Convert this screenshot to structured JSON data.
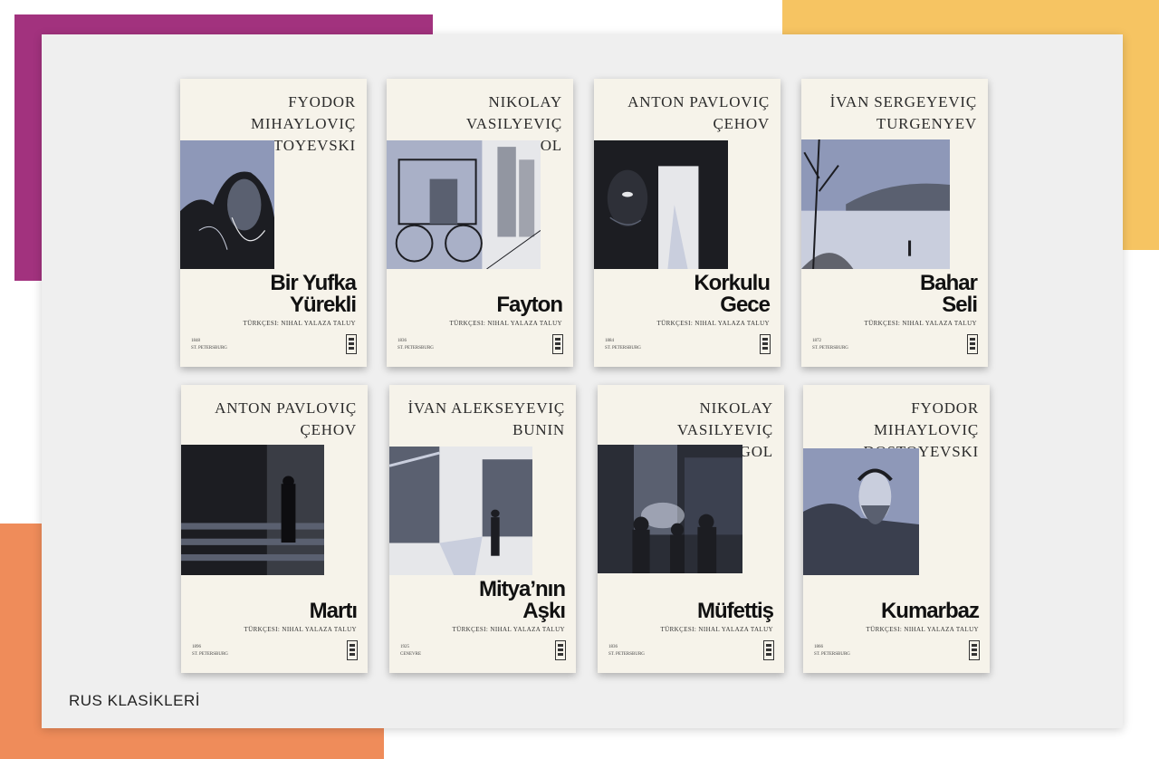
{
  "page": {
    "footer_label": "RUS KLASİKLERİ",
    "colors": {
      "magenta": "#a2327e",
      "yellow": "#f6c462",
      "orange": "#ef8c5a",
      "panel": "#efefef",
      "cover": "#f6f3ea",
      "art_tint": "#8e98b8"
    }
  },
  "books": [
    {
      "author": [
        "Fyodor Mihayloviç",
        "Dostoyevski"
      ],
      "title": [
        "Bir Yufka",
        "Yürekli"
      ],
      "translator": "Türkçesi: Nihal Yalaza Taluy",
      "meta": [
        "1848",
        "St. Petersburg"
      ],
      "art": "portrait-head-bowed"
    },
    {
      "author": [
        "Nikolay Vasilyeviç",
        "Gogol"
      ],
      "title": [
        "Fayton"
      ],
      "translator": "Türkçesi: Nihal Yalaza Taluy",
      "meta": [
        "1836",
        "St. Petersburg"
      ],
      "art": "carriage-street"
    },
    {
      "author": [
        "Anton Pavloviç",
        "Çehov"
      ],
      "title": [
        "Korkulu",
        "Gece"
      ],
      "translator": "Türkçesi: Nihal Yalaza Taluy",
      "meta": [
        "1884",
        "St. Petersburg"
      ],
      "art": "face-in-doorway"
    },
    {
      "author": [
        "İvan Sergeyeviç",
        "Turgenyev"
      ],
      "title": [
        "Bahar",
        "Seli"
      ],
      "translator": "Türkçesi: Nihal Yalaza Taluy",
      "meta": [
        "1872",
        "St. Petersburg"
      ],
      "art": "river-landscape"
    },
    {
      "author": [
        "Anton Pavloviç",
        "Çehov"
      ],
      "title": [
        "Martı"
      ],
      "translator": "Türkçesi: Nihal Yalaza Taluy",
      "meta": [
        "1896",
        "St. Petersburg"
      ],
      "art": "figure-on-stairs"
    },
    {
      "author": [
        "İvan Alekseyeviç",
        "Bunin"
      ],
      "title": [
        "Mitya’nın",
        "Aşkı"
      ],
      "translator": "Türkçesi: Nihal Yalaza Taluy",
      "meta": [
        "1925",
        "Cenevre"
      ],
      "art": "snowy-street"
    },
    {
      "author": [
        "Nikolay Vasilyeviç",
        "Gogol"
      ],
      "title": [
        "Müfettiş"
      ],
      "translator": "Türkçesi: Nihal Yalaza Taluy",
      "meta": [
        "1836",
        "St. Petersburg"
      ],
      "art": "crowd-night-street"
    },
    {
      "author": [
        "Fyodor Mihayloviç",
        "Dostoyevski"
      ],
      "title": [
        "Kumarbaz"
      ],
      "translator": "Türkçesi: Nihal Yalaza Taluy",
      "meta": [
        "1866",
        "St. Petersburg"
      ],
      "art": "bearded-man-portrait"
    }
  ]
}
